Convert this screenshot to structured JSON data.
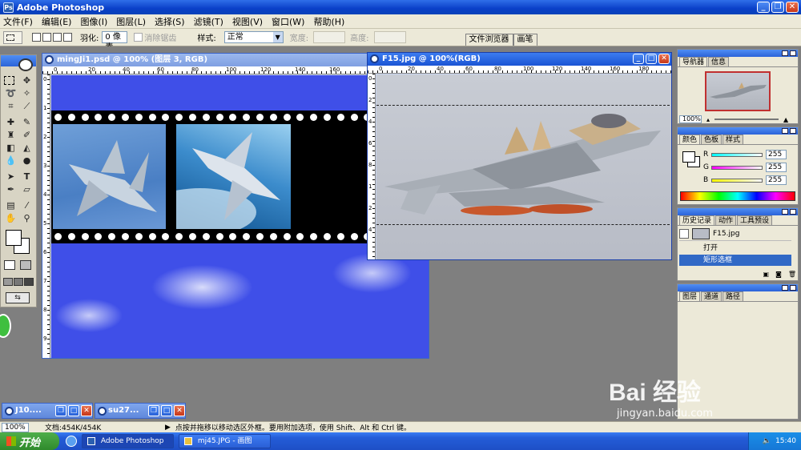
{
  "app": {
    "title": "Adobe Photoshop"
  },
  "menu": [
    "文件(F)",
    "编辑(E)",
    "图像(I)",
    "图层(L)",
    "选择(S)",
    "滤镜(T)",
    "视图(V)",
    "窗口(W)",
    "帮助(H)"
  ],
  "options": {
    "feather_label": "羽化:",
    "feather_value": "0 像素",
    "antialias_label": "消除锯齿",
    "style_label": "样式:",
    "style_value": "正常",
    "width_label": "宽度:",
    "height_label": "高度:",
    "palette_well_tabs": [
      "文件浏览器",
      "画笔"
    ]
  },
  "doc1": {
    "title": "mingJi1.psd @ 100% (图层 3, RGB)",
    "ruler_labels": [
      "0",
      "20",
      "40",
      "60",
      "80",
      "100",
      "120",
      "140",
      "160"
    ],
    "ruler_v_labels": [
      "0",
      "1",
      "2",
      "3",
      "4",
      "5",
      "6",
      "7",
      "8",
      "9"
    ]
  },
  "doc2": {
    "title": "F15.jpg @ 100%(RGB)",
    "ruler_labels": [
      "0",
      "20",
      "40",
      "60",
      "80",
      "100",
      "120",
      "140",
      "160",
      "180"
    ],
    "ruler_v_labels": [
      "0",
      "2",
      "4",
      "6",
      "8",
      "1",
      "2",
      "4"
    ]
  },
  "minimized": [
    {
      "title": "J10...."
    },
    {
      "title": "su27..."
    }
  ],
  "palettes": {
    "navigator": {
      "tabs": [
        "导航器",
        "信息"
      ],
      "zoom": "100%"
    },
    "color": {
      "tabs": [
        "颜色",
        "色板",
        "样式"
      ],
      "channels": [
        {
          "label": "R",
          "value": "255",
          "color": "#d02020"
        },
        {
          "label": "G",
          "value": "255",
          "color": "#20c020"
        },
        {
          "label": "B",
          "value": "255",
          "color": "#2020d0"
        }
      ]
    },
    "history": {
      "tabs": [
        "历史记录",
        "动作",
        "工具预设"
      ],
      "snapshot": "F15.jpg",
      "items": [
        "打开",
        "矩形选框"
      ]
    },
    "layers": {
      "tabs": [
        "图层",
        "通道",
        "路径"
      ]
    }
  },
  "status": {
    "zoom": "100%",
    "doc_size": "文档:454K/454K",
    "hint": "点按并拖移以移动选区外框。要用附加选项，使用 Shift、Alt 和 Ctrl 键。"
  },
  "taskbar": {
    "start": "开始",
    "items": [
      "Adobe Photoshop",
      "mj45.JPG - 画图"
    ],
    "clock": "15:40"
  },
  "watermark": {
    "text": "Bai 经验",
    "url": "jingyan.baidu.com"
  },
  "colors": {
    "title_blue": "#0a3fc8",
    "sky": "#3f4fe8",
    "selection": "#3169c6"
  }
}
